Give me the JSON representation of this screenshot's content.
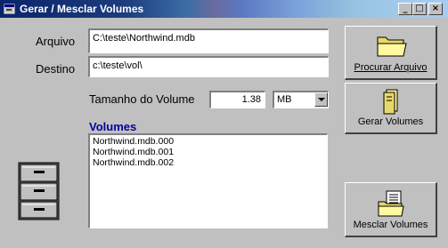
{
  "window": {
    "title": "Gerar / Mesclar Volumes",
    "minimize_glyph": "_",
    "maximize_glyph": "□",
    "close_glyph": "×"
  },
  "form": {
    "arquivo_label": "Arquivo",
    "arquivo_value": "C:\\teste\\Northwind.mdb",
    "destino_label": "Destino",
    "destino_value": "c:\\teste\\vol\\",
    "tamanho_label": "Tamanho do  Volume",
    "tamanho_value": "1.38",
    "unit_value": "MB"
  },
  "volumes": {
    "title": "Volumes",
    "items": [
      "Northwind.mdb.000",
      "Northwind.mdb.001",
      "Northwind.mdb.002"
    ]
  },
  "buttons": {
    "procurar": "Procurar Arquivo",
    "gerar": "Gerar Volumes",
    "mesclar": "Mesclar Volumes"
  },
  "icons": {
    "app": "app-window-icon",
    "cabinet": "file-cabinet-icon",
    "folder": "folder-icon",
    "split": "split-file-icon",
    "merge": "merge-documents-icon"
  }
}
